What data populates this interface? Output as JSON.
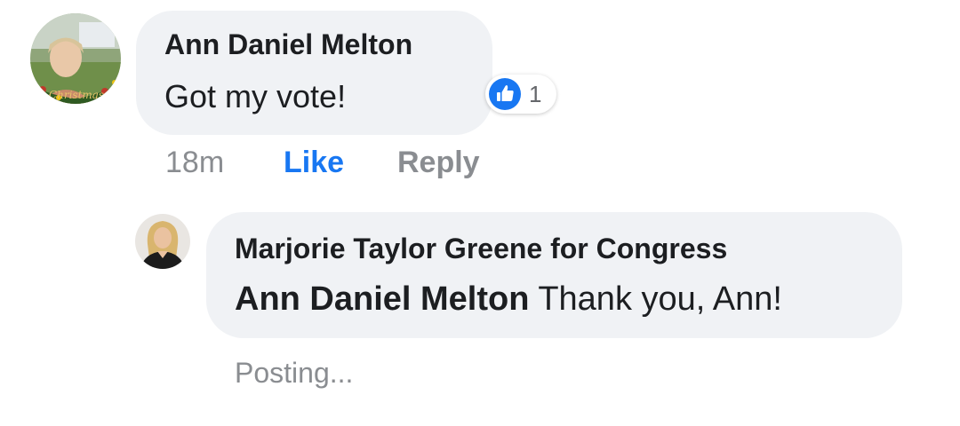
{
  "comment": {
    "author": "Ann Daniel Melton",
    "text": "Got my vote!",
    "reaction": {
      "icon": "thumbs-up-icon",
      "color": "#1877f2",
      "count": "1"
    },
    "time": "18m",
    "like_label": "Like",
    "reply_label": "Reply",
    "avatar_icon": "profile-photo-christmas-frame"
  },
  "reply": {
    "author": "Marjorie Taylor Greene for Congress",
    "mention": "Ann Daniel Melton",
    "text": "Thank you, Ann!",
    "status": "Posting...",
    "avatar_icon": "profile-photo"
  },
  "colors": {
    "bubble": "#f0f2f5",
    "text": "#1c1e21",
    "muted": "#8a8d91",
    "link": "#1877f2"
  }
}
